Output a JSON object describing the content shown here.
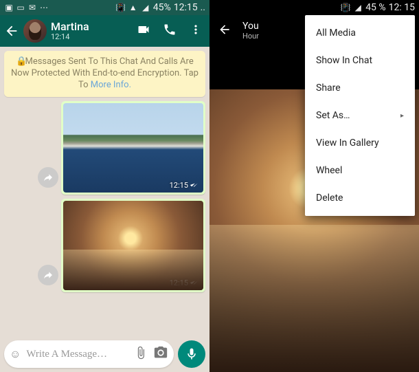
{
  "status_left": {
    "battery_text": "45%",
    "time": "12:15"
  },
  "status_right": {
    "battery_text": "45 %",
    "time": "12: 15"
  },
  "chat": {
    "contact_name": "Martina",
    "last_seen": "12:14",
    "encryption_notice": "Messages Sent To This Chat And Calls Are Now Protected With End-to-end Encryption. Tap To",
    "encryption_more": "More Info.",
    "messages": [
      {
        "type": "photo",
        "variant": "harbor",
        "timestamp": "12:15"
      },
      {
        "type": "photo",
        "variant": "sunset",
        "timestamp": "12:15"
      }
    ],
    "composer_placeholder": "Write A Message…"
  },
  "viewer": {
    "title": "You",
    "subtitle": "Hour",
    "menu": [
      {
        "label": "All Media"
      },
      {
        "label": "Show In Chat"
      },
      {
        "label": "Share"
      },
      {
        "label": "Set As…",
        "has_submenu": true
      },
      {
        "label": "View In Gallery"
      },
      {
        "label": "Wheel"
      },
      {
        "label": "Delete"
      }
    ]
  }
}
